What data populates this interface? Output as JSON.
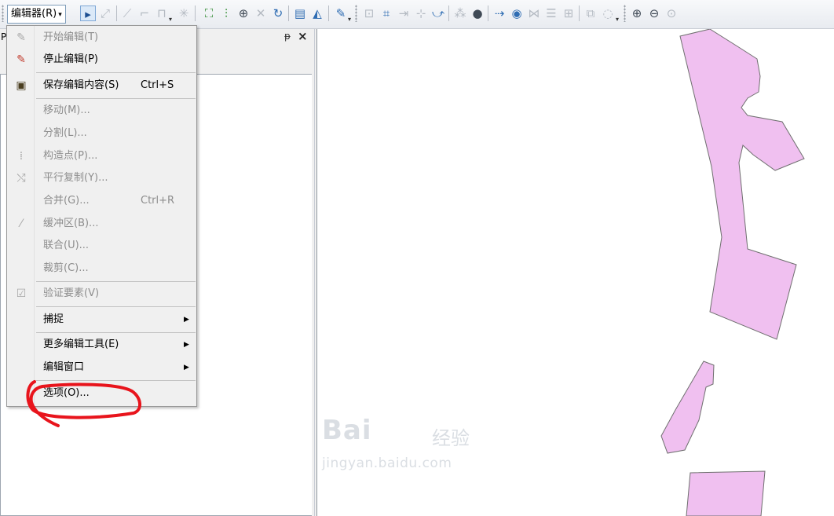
{
  "toolbar": {
    "editor_menu_label": "编辑器(R)",
    "editor_menu_caret": "▾",
    "icons": [
      "edit-tool-icon",
      "edit-annotation-icon",
      "straight-segment-icon",
      "trace-icon",
      "construct-point-icon",
      "midpoint-icon",
      "edit-vertices-icon",
      "reshape-feature-icon",
      "cut-polygons-icon",
      "split-icon",
      "rotate-icon",
      "attributes-icon",
      "sketch-properties-icon",
      "create-features-icon",
      "topology-icon",
      "snapping-icon",
      "validate-icon",
      "georeferencing-icon",
      "spatial-adjustment-icon",
      "map-topology-icon"
    ]
  },
  "panel": {
    "title_char": "P",
    "pin_glyph": "ᵖ",
    "close_glyph": "×"
  },
  "menu": {
    "items": [
      {
        "label": "开始编辑(T)",
        "shortcut": "",
        "enabled": false,
        "submenu": false,
        "icon": "start-editing-icon"
      },
      {
        "label": "停止编辑(P)",
        "shortcut": "",
        "enabled": true,
        "submenu": false,
        "icon": "stop-editing-icon"
      },
      {
        "label": "保存编辑内容(S)",
        "shortcut": "Ctrl+S",
        "enabled": true,
        "submenu": false,
        "icon": "save-edits-icon"
      },
      {
        "label": "移动(M)...",
        "shortcut": "",
        "enabled": false,
        "submenu": false,
        "icon": ""
      },
      {
        "label": "分割(L)...",
        "shortcut": "",
        "enabled": false,
        "submenu": false,
        "icon": ""
      },
      {
        "label": "构造点(P)...",
        "shortcut": "",
        "enabled": false,
        "submenu": false,
        "icon": "construct-points-icon"
      },
      {
        "label": "平行复制(Y)...",
        "shortcut": "",
        "enabled": false,
        "submenu": false,
        "icon": "copy-parallel-icon"
      },
      {
        "label": "合并(G)...",
        "shortcut": "Ctrl+R",
        "enabled": false,
        "submenu": false,
        "icon": ""
      },
      {
        "label": "缓冲区(B)...",
        "shortcut": "",
        "enabled": false,
        "submenu": false,
        "icon": "buffer-icon"
      },
      {
        "label": "联合(U)...",
        "shortcut": "",
        "enabled": false,
        "submenu": false,
        "icon": ""
      },
      {
        "label": "裁剪(C)...",
        "shortcut": "",
        "enabled": false,
        "submenu": false,
        "icon": ""
      },
      {
        "label": "验证要素(V)",
        "shortcut": "",
        "enabled": false,
        "submenu": false,
        "icon": "validate-features-icon"
      },
      {
        "label": "捕捉",
        "shortcut": "",
        "enabled": true,
        "submenu": true,
        "icon": ""
      },
      {
        "label": "更多编辑工具(E)",
        "shortcut": "",
        "enabled": true,
        "submenu": true,
        "icon": ""
      },
      {
        "label": "编辑窗口",
        "shortcut": "",
        "enabled": true,
        "submenu": true,
        "icon": ""
      },
      {
        "label": "选项(O)...",
        "shortcut": "",
        "enabled": true,
        "submenu": false,
        "icon": ""
      }
    ]
  },
  "map": {
    "polygon_fill": "#f0c0f0",
    "polygon_stroke": "#6f6f6f"
  },
  "watermark": {
    "logo": "Bai",
    "brand": "经验",
    "url": "jingyan.baidu.com"
  },
  "annotation_color": "#e8141c"
}
